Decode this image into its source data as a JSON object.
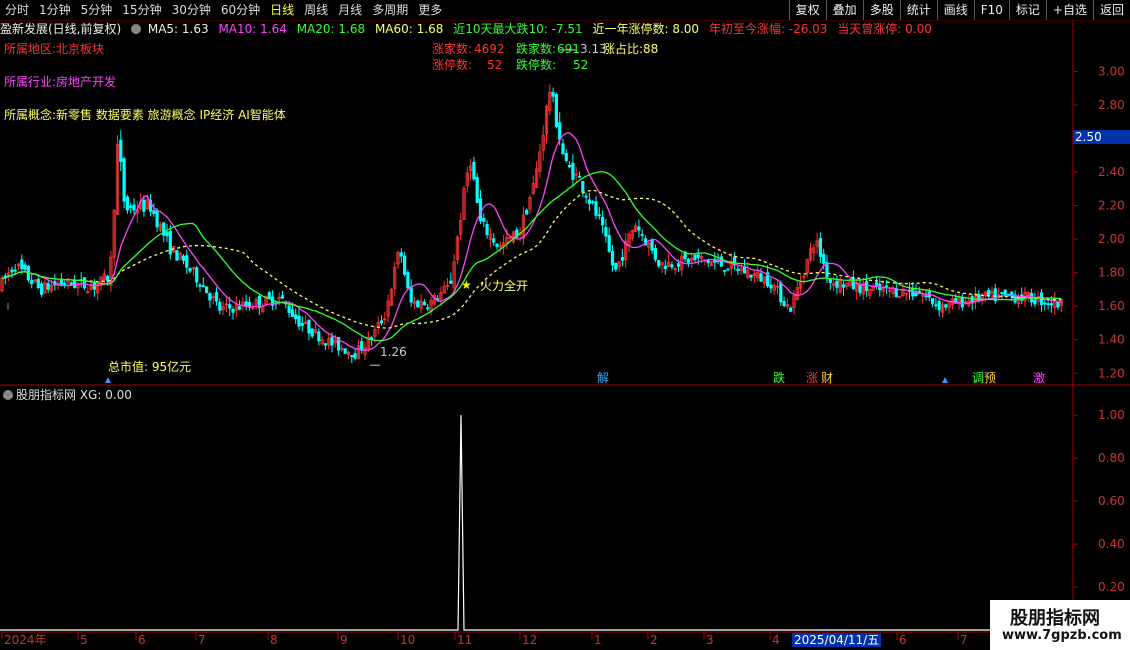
{
  "toolbar": {
    "tabs": [
      "分时",
      "1分钟",
      "5分钟",
      "15分钟",
      "30分钟",
      "60分钟",
      "日线",
      "周线",
      "月线",
      "多周期",
      "更多"
    ],
    "active_tab": "日线",
    "right_buttons": [
      "复权",
      "叠加",
      "多股",
      "统计",
      "画线",
      "F10",
      "标记",
      "+自选",
      "返回"
    ]
  },
  "info": {
    "stock_name": "盈新发展(日线,前复权)",
    "ma5": "MA5: 1.63",
    "ma10": "MA10: 1.64",
    "ma20": "MA20: 1.68",
    "ma60": "MA60: 1.68",
    "drop10": "近10天最大跌10: -7.51",
    "limitup_year": "近一年涨停数: 8.00",
    "ytd": "年初至今涨幅: -26.03",
    "today_limit": "当天曾涨停: 0.00"
  },
  "labels": {
    "region": "所属地区:北京板块",
    "industry": "所属行业:房地产开发",
    "concept": "所属概念:新零售 数据要素 旅游概念 IP经济 AI智能体",
    "up_count_label": "涨家数:",
    "up_count": "4692",
    "down_count_label": "跌家数:",
    "down_count": "691",
    "limitup_label": "涨停数:",
    "limitup": "52",
    "limitdown_label": "跌停数:",
    "limitdown": "52",
    "up_ratio": "涨占比:88",
    "high_mark": "3.13",
    "low_mark": "1.26",
    "signal_text": "火力全开",
    "market_cap": "总市值: 95亿元",
    "price_tag": "2.50",
    "indicator_title": "股朋指标网 XG: 0.00",
    "cursor_date": "2025/04/11/五"
  },
  "events": [
    "解",
    "跌",
    "涨",
    "财",
    "调",
    "预",
    "激"
  ],
  "price_axis": [
    "3.00",
    "2.80",
    "2.60",
    "2.40",
    "2.20",
    "2.00",
    "1.80",
    "1.60",
    "1.40",
    "1.20"
  ],
  "ind_axis": [
    "1.00",
    "0.80",
    "0.60",
    "0.40",
    "0.20"
  ],
  "months": [
    "2024年",
    "5",
    "6",
    "7",
    "8",
    "9",
    "10",
    "11",
    "12",
    "1",
    "2",
    "3",
    "4",
    "6",
    "7"
  ],
  "logo": {
    "line1": "股朋指标网",
    "line2": "www.7gpzb.com"
  },
  "colors": {
    "up": "#ff3333",
    "down": "#00ffff",
    "ma5": "#ff44ff",
    "ma20": "#33ff33",
    "ma60": "#ffff66"
  },
  "chart_data": [
    {
      "type": "candlestick",
      "title": "",
      "y_range": [
        1.13,
        3.2
      ],
      "x_range": [
        "2024-04",
        "2025-07"
      ],
      "price_summary": {
        "high": 3.13,
        "low": 1.26,
        "last": 1.61
      },
      "series": [
        {
          "name": "MA5",
          "values": [
            1.63
          ]
        },
        {
          "name": "MA10",
          "values": [
            1.64
          ]
        },
        {
          "name": "MA20",
          "values": [
            1.68
          ]
        },
        {
          "name": "MA60",
          "values": [
            1.68
          ]
        }
      ]
    },
    {
      "type": "line",
      "title": "",
      "y_range": [
        0,
        1.08
      ],
      "series": [
        {
          "name": "XG",
          "values": [
            0,
            0,
            1,
            0,
            0
          ]
        }
      ]
    }
  ]
}
